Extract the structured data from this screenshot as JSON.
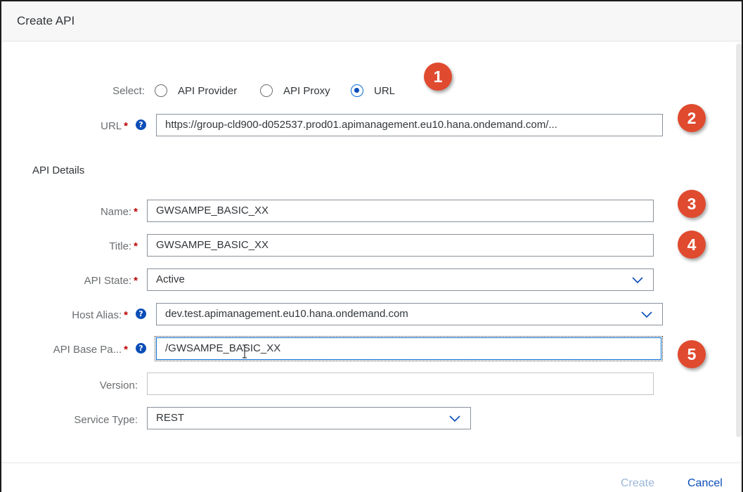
{
  "dialog": {
    "title": "Create API"
  },
  "select": {
    "label": "Select:",
    "options": [
      "API Provider",
      "API Proxy",
      "URL"
    ],
    "selected": "URL"
  },
  "url": {
    "label": "URL",
    "value": "https://group-cld900-d052537.prod01.apimanagement.eu10.hana.ondemand.com/..."
  },
  "api_details": {
    "section_title": "API Details",
    "name": {
      "label": "Name:",
      "value": "GWSAMPE_BASIC_XX"
    },
    "title": {
      "label": "Title:",
      "value": "GWSAMPE_BASIC_XX"
    },
    "api_state": {
      "label": "API State:",
      "value": "Active"
    },
    "host_alias": {
      "label": "Host Alias:",
      "value": "dev.test.apimanagement.eu10.hana.ondemand.com"
    },
    "base_path": {
      "label": "API Base Pa...",
      "value": "/GWSAMPE_BASIC_XX"
    },
    "version": {
      "label": "Version:",
      "value": ""
    },
    "service_type": {
      "label": "Service Type:",
      "value": "REST"
    }
  },
  "required_marker": "*",
  "help_icon_glyph": "?",
  "callouts": [
    "1",
    "2",
    "3",
    "4",
    "5"
  ],
  "footer": {
    "create_label": "Create",
    "cancel_label": "Cancel"
  },
  "colors": {
    "accent": "#0a4db7",
    "required": "#bb0000",
    "callout": "#e04a2f"
  }
}
